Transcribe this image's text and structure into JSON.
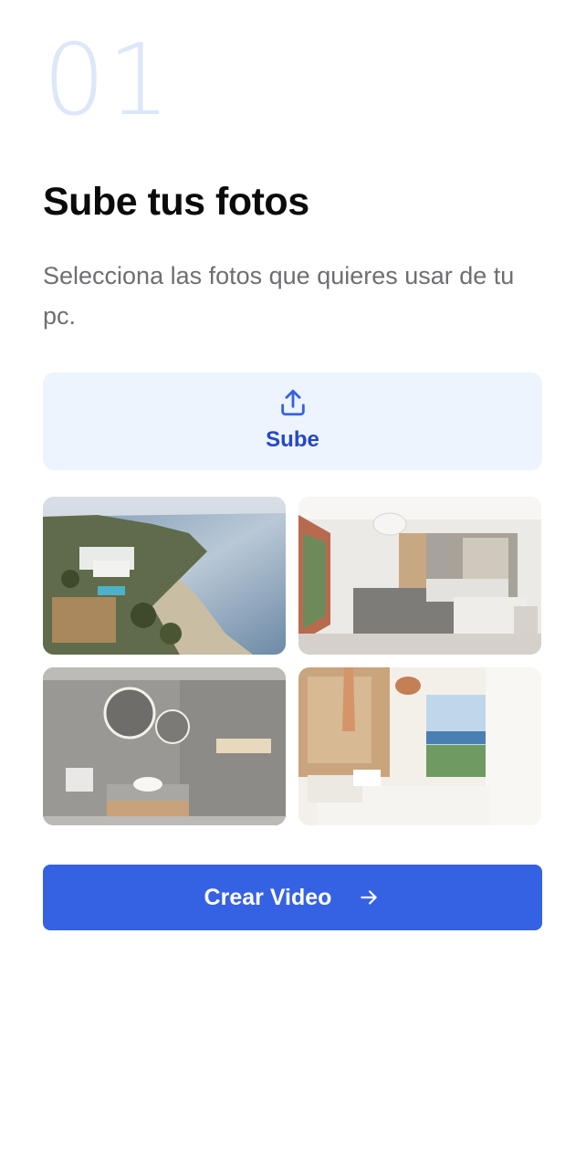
{
  "step": {
    "number": "01",
    "title": "Sube tus fotos",
    "description": "Selecciona las fotos que quieres usar de tu pc."
  },
  "upload": {
    "label": "Sube",
    "icon": "upload-icon"
  },
  "photos": [
    {
      "name": "photo-coastal-aerial"
    },
    {
      "name": "photo-bedroom-white"
    },
    {
      "name": "photo-bathroom-gray"
    },
    {
      "name": "photo-bedroom-terrace"
    }
  ],
  "create_button": {
    "label": "Crear Video",
    "icon": "arrow-right-icon"
  },
  "colors": {
    "accent": "#3562e3",
    "upload_bg": "#eef4fd",
    "upload_text": "#2547c6",
    "step_number": "#dde7fa",
    "title": "#0b0b0c",
    "description": "#6e6e73"
  }
}
